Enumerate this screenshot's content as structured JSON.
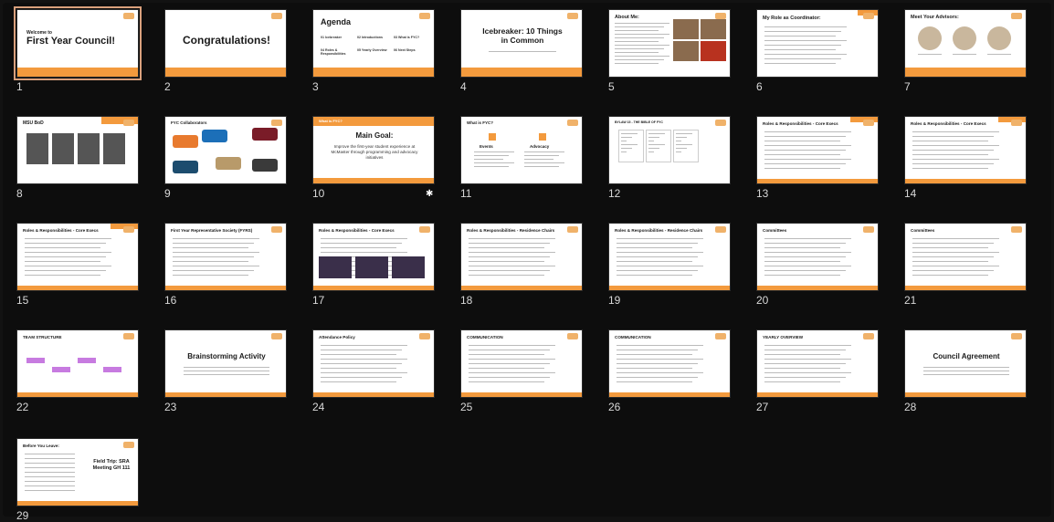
{
  "slides": [
    {
      "n": "1",
      "title": "First Year Council!",
      "sub": "Welcome to"
    },
    {
      "n": "2",
      "title": "Congratulations!"
    },
    {
      "n": "3",
      "title": "Agenda",
      "items": [
        "01 Icebreaker",
        "02 Introductions",
        "03 What is FYC?",
        "04 Roles & Responsibilities",
        "05 Yearly Overview",
        "06 Next Steps"
      ]
    },
    {
      "n": "4",
      "title": "Icebreaker: 10 Things in Common"
    },
    {
      "n": "5",
      "title": "About Me:"
    },
    {
      "n": "6",
      "title": "My Role as Coordinator:"
    },
    {
      "n": "7",
      "title": "Meet Your Advisors:"
    },
    {
      "n": "8",
      "title": "MSU BoD"
    },
    {
      "n": "9",
      "title": "FYC Collaborators"
    },
    {
      "n": "10",
      "title": "Main Goal:",
      "kicker": "What is FYC?",
      "body": "Improve the first-year student experience at McMaster through programming and advocacy initiatives"
    },
    {
      "n": "11",
      "title": "What is FYC?",
      "cols": [
        "Events",
        "Advocacy"
      ]
    },
    {
      "n": "12",
      "title": "BYLAW 15 - THE BIBLE OF FYC"
    },
    {
      "n": "13",
      "title": "Roles & Responsibilities - Core Execs"
    },
    {
      "n": "14",
      "title": "Roles & Responsibilities - Core Execs"
    },
    {
      "n": "15",
      "title": "Roles & Responsibilities - Core Execs"
    },
    {
      "n": "16",
      "title": "First Year Representative Society (FYRS)"
    },
    {
      "n": "17",
      "title": "Roles & Responsibilities - Core Execs"
    },
    {
      "n": "18",
      "title": "Roles & Responsibilities - Residence Chairs"
    },
    {
      "n": "19",
      "title": "Roles & Responsibilities - Residence Chairs"
    },
    {
      "n": "20",
      "title": "Committees"
    },
    {
      "n": "21",
      "title": "Committees"
    },
    {
      "n": "22",
      "title": "TEAM STRUCTURE"
    },
    {
      "n": "23",
      "title": "Brainstorming Activity"
    },
    {
      "n": "24",
      "title": "Attendance Policy"
    },
    {
      "n": "25",
      "title": "COMMUNICATION"
    },
    {
      "n": "26",
      "title": "COMMUNICATION"
    },
    {
      "n": "27",
      "title": "YEARLY OVERVIEW"
    },
    {
      "n": "28",
      "title": "Council Agreement"
    },
    {
      "n": "29",
      "title": "Before You Leave:",
      "side": "Field Trip: SRA Meeting GH 111"
    }
  ],
  "colors": {
    "accent": "#f39a3d",
    "background": "#121212",
    "selected": "#d9a07c"
  }
}
